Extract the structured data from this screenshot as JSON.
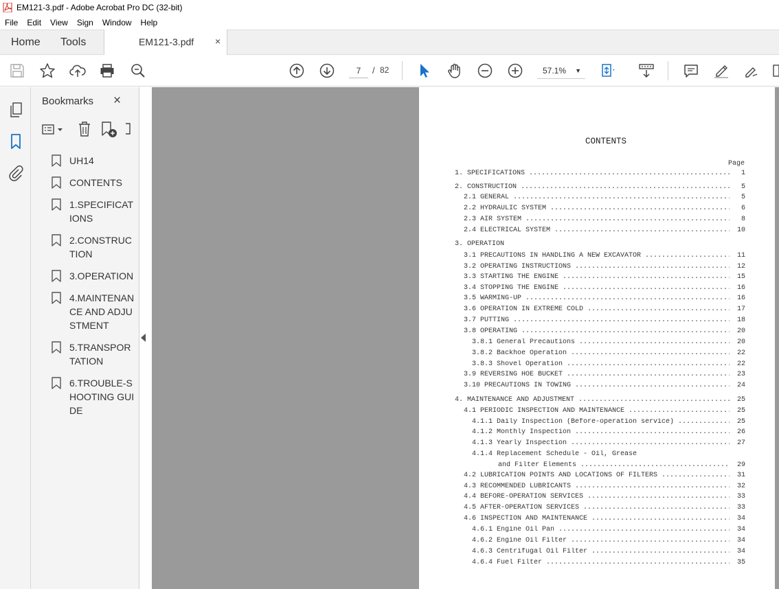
{
  "window": {
    "title": "EM121-3.pdf - Adobe Acrobat Pro DC (32-bit)"
  },
  "menu": [
    "File",
    "Edit",
    "View",
    "Sign",
    "Window",
    "Help"
  ],
  "tabs": {
    "home": "Home",
    "tools": "Tools",
    "document": "EM121-3.pdf",
    "close": "×"
  },
  "toolbar": {
    "current_page": "7",
    "page_separator": "/",
    "total_pages": "82",
    "zoom": "57.1%"
  },
  "bookmarks": {
    "title": "Bookmarks",
    "close": "×",
    "items": [
      {
        "label": "UH14"
      },
      {
        "label": "CONTENTS"
      },
      {
        "label": "1.SPECIFICATIONS"
      },
      {
        "label": "2.CONSTRUCTION"
      },
      {
        "label": "3.OPERATION"
      },
      {
        "label": "4.MAINTENANCE AND ADJUSTMENT"
      },
      {
        "label": "5.TRANSPORTATION"
      },
      {
        "label": "6.TROUBLE-SHOOTING GUIDE"
      }
    ]
  },
  "document": {
    "heading": "CONTENTS",
    "page_col": "Page",
    "entries": [
      {
        "text": "1. SPECIFICATIONS",
        "page": "1",
        "indent": 0
      },
      {
        "text": "2. CONSTRUCTION",
        "page": "5",
        "indent": 0
      },
      {
        "text": "2.1 GENERAL",
        "page": "5",
        "indent": 1
      },
      {
        "text": "2.2 HYDRAULIC SYSTEM",
        "page": "6",
        "indent": 1
      },
      {
        "text": "2.3 AIR SYSTEM",
        "page": "8",
        "indent": 1
      },
      {
        "text": "2.4 ELECTRICAL SYSTEM",
        "page": "10",
        "indent": 1
      },
      {
        "text": "3. OPERATION",
        "page": "",
        "indent": 0
      },
      {
        "text": "3.1 PRECAUTIONS IN HANDLING A NEW EXCAVATOR",
        "page": "11",
        "indent": 1
      },
      {
        "text": "3.2 OPERATING INSTRUCTIONS",
        "page": "12",
        "indent": 1
      },
      {
        "text": "3.3 STARTING THE ENGINE",
        "page": "15",
        "indent": 1
      },
      {
        "text": "3.4 STOPPING THE ENGINE",
        "page": "16",
        "indent": 1
      },
      {
        "text": "3.5 WARMING-UP",
        "page": "16",
        "indent": 1
      },
      {
        "text": "3.6 OPERATION IN EXTREME COLD",
        "page": "17",
        "indent": 1
      },
      {
        "text": "3.7 PUTTING",
        "page": "18",
        "indent": 1
      },
      {
        "text": "3.8 OPERATING",
        "page": "20",
        "indent": 1
      },
      {
        "text": "3.8.1 General Precautions",
        "page": "20",
        "indent": 2
      },
      {
        "text": "3.8.2 Backhoe Operation",
        "page": "22",
        "indent": 2
      },
      {
        "text": "3.8.3 Shovel Operation",
        "page": "22",
        "indent": 2
      },
      {
        "text": "3.9 REVERSING HOE BUCKET",
        "page": "23",
        "indent": 1
      },
      {
        "text": "3.10 PRECAUTIONS IN TOWING",
        "page": "24",
        "indent": 1
      },
      {
        "text": "4. MAINTENANCE AND ADJUSTMENT",
        "page": "25",
        "indent": 0
      },
      {
        "text": "4.1 PERIODIC INSPECTION AND MAINTENANCE",
        "page": "25",
        "indent": 1
      },
      {
        "text": "4.1.1 Daily Inspection (Before-operation service)",
        "page": "25",
        "indent": 2
      },
      {
        "text": "4.1.2 Monthly Inspection",
        "page": "26",
        "indent": 2
      },
      {
        "text": "4.1.3 Yearly Inspection",
        "page": "27",
        "indent": 2
      },
      {
        "text": "4.1.4 Replacement Schedule - Oil, Grease",
        "page": "",
        "indent": 2
      },
      {
        "text": "and Filter Elements",
        "page": "29",
        "indent": 3
      },
      {
        "text": "4.2 LUBRICATION POINTS AND LOCATIONS OF FILTERS",
        "page": "31",
        "indent": 1
      },
      {
        "text": "4.3 RECOMMENDED LUBRICANTS",
        "page": "32",
        "indent": 1
      },
      {
        "text": "4.4 BEFORE-OPERATION SERVICES",
        "page": "33",
        "indent": 1
      },
      {
        "text": "4.5 AFTER-OPERATION SERVICES",
        "page": "33",
        "indent": 1
      },
      {
        "text": "4.6 INSPECTION AND MAINTENANCE",
        "page": "34",
        "indent": 1
      },
      {
        "text": "4.6.1 Engine Oil Pan",
        "page": "34",
        "indent": 2
      },
      {
        "text": "4.6.2 Engine Oil Filter",
        "page": "34",
        "indent": 2
      },
      {
        "text": "4.6.3 Centrifugal Oil Filter",
        "page": "34",
        "indent": 2
      },
      {
        "text": "4.6.4 Fuel Filter",
        "page": "35",
        "indent": 2
      }
    ]
  }
}
